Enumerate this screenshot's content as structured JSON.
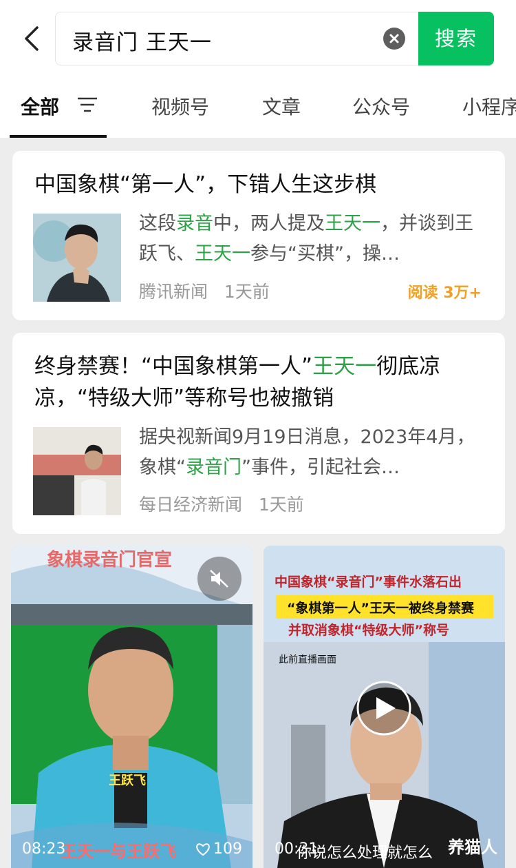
{
  "search": {
    "query": "录音门 王天一",
    "button": "搜索"
  },
  "tabs": [
    "全部",
    "视频号",
    "文章",
    "公众号",
    "小程序"
  ],
  "articles": [
    {
      "title": "中国象棋“第一人”，下错人生这步棋",
      "snippet_parts": [
        "这段",
        "录音",
        "中，两人提及",
        "王天一",
        "，并谈到王跃飞、",
        "王天一",
        "参与“买棋”，操…"
      ],
      "source": "腾讯新闻",
      "time": "1天前",
      "reads": "阅读 3万+"
    },
    {
      "title": "终身禁赛！“中国象棋第一人”王天一彻底凉凉，“特级大师”等称号也被撤销",
      "title_parts": [
        "终身禁赛！“中国象棋第一人”",
        "王天一",
        "彻底凉凉，“特级大师”等称号也被撤销"
      ],
      "snippet_parts": [
        "据央视新闻9月19日消息，2023年4月，象棋“",
        "录音门",
        "”事件，引起社会…"
      ],
      "source": "每日经济新闻",
      "time": "1天前"
    }
  ],
  "videos": [
    {
      "banner": "象棋录音门官宣",
      "name_tag": "王跃飞",
      "caption": "王天一与王跃飞",
      "duration": "08:23",
      "likes": "109",
      "colors": {
        "sky": "#bcd3e6",
        "green": "#1a9a3a",
        "shirt": "#3fb7d8"
      }
    },
    {
      "headline1": "中国象棋“录音门”事件水落石出",
      "headline2": "“象棋第一人”王天一被终身禁赛",
      "headline3": "并取消象棋“特级大师”称号",
      "label": "此前直播画面",
      "caption": "你说怎么处理就怎么",
      "duration": "00:31",
      "watermark": "养猫人"
    }
  ],
  "colors": {
    "accent": "#07c160",
    "highlight": "#2ba245",
    "reads": "#f0a027"
  }
}
